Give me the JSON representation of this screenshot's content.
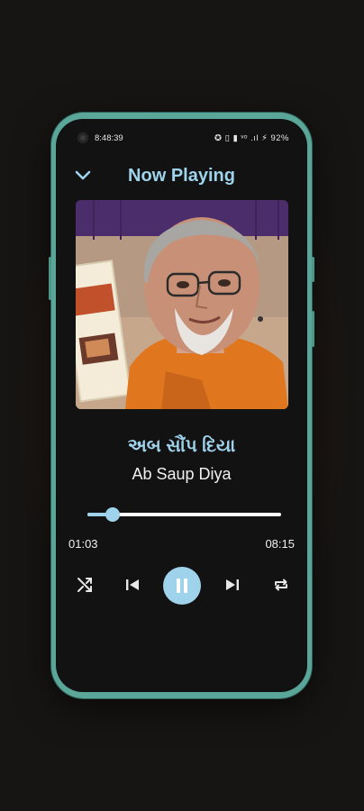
{
  "status_bar": {
    "time": "8:48:39",
    "icons": "✪ ▯ ▮ ᵛᵒ .ıl ⚡ 92%"
  },
  "header": {
    "title": "Now Playing",
    "back_icon": "chevron-down-icon"
  },
  "track": {
    "title_gujarati": "અબ સૌંપ દિયા",
    "title_english": "Ab Saup Diya"
  },
  "player": {
    "elapsed": "01:03",
    "duration": "08:15",
    "progress": 0.13,
    "state": "playing"
  },
  "controls": {
    "shuffle": "shuffle-icon",
    "previous": "skip-previous-icon",
    "play_pause": "pause-icon",
    "next": "skip-next-icon",
    "repeat": "repeat-icon"
  },
  "colors": {
    "accent": "#9fd3ec",
    "screen_background": "#121212",
    "phone_frame": "#5aa79a"
  }
}
